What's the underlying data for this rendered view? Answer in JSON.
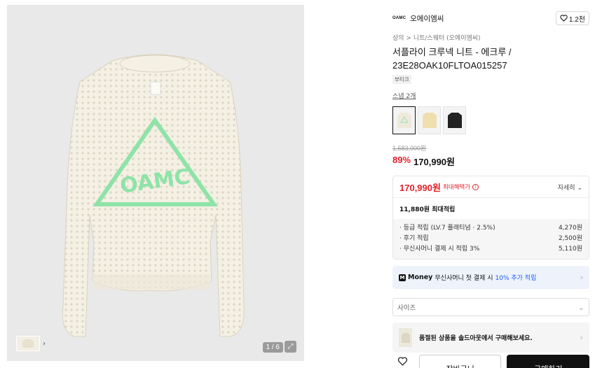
{
  "gallery": {
    "counter": "1 / 6"
  },
  "brand": {
    "logo_text": "OAMC",
    "name": "오에이엠씨",
    "likes": "1.2천"
  },
  "breadcrumb": "상의 > 니트/스웨터 (오에이엠씨)",
  "product": {
    "title": "서플라이 크루넥 니트 - 에크루 / 23E28OAK10FLTOA015257",
    "tag": "부티크",
    "snap_link": "스냅 2개",
    "original_price": "1,583,000원",
    "discount": "89%",
    "sale_price": "170,990원"
  },
  "colors": {
    "options": [
      "ecru",
      "yellow",
      "black"
    ],
    "accent": "#e3212b"
  },
  "benefit": {
    "max_price": "170,990원",
    "max_label": "최대혜택가",
    "detail_label": "자세히",
    "accum_title": "11,880원 최대적립",
    "items": [
      {
        "label": "· 등급 적립 (LV.7 플래티넘 · 2.5%)",
        "value": "4,270원"
      },
      {
        "label": "· 후기 적립",
        "value": "2,500원"
      },
      {
        "label": "· 무신사머니 결제 시 적립 3%",
        "value": "5,110원"
      }
    ]
  },
  "money": {
    "logo": "M",
    "brand": "Money",
    "text_before": "무신사머니 첫 결제 시 ",
    "highlight": "10% 추가 적립"
  },
  "size": {
    "placeholder": "사이즈"
  },
  "soldout": {
    "text": "품절된 상품을 솔드아웃에서 구매해보세요."
  },
  "actions": {
    "cart": "장바구니",
    "buy": "구매하기"
  }
}
